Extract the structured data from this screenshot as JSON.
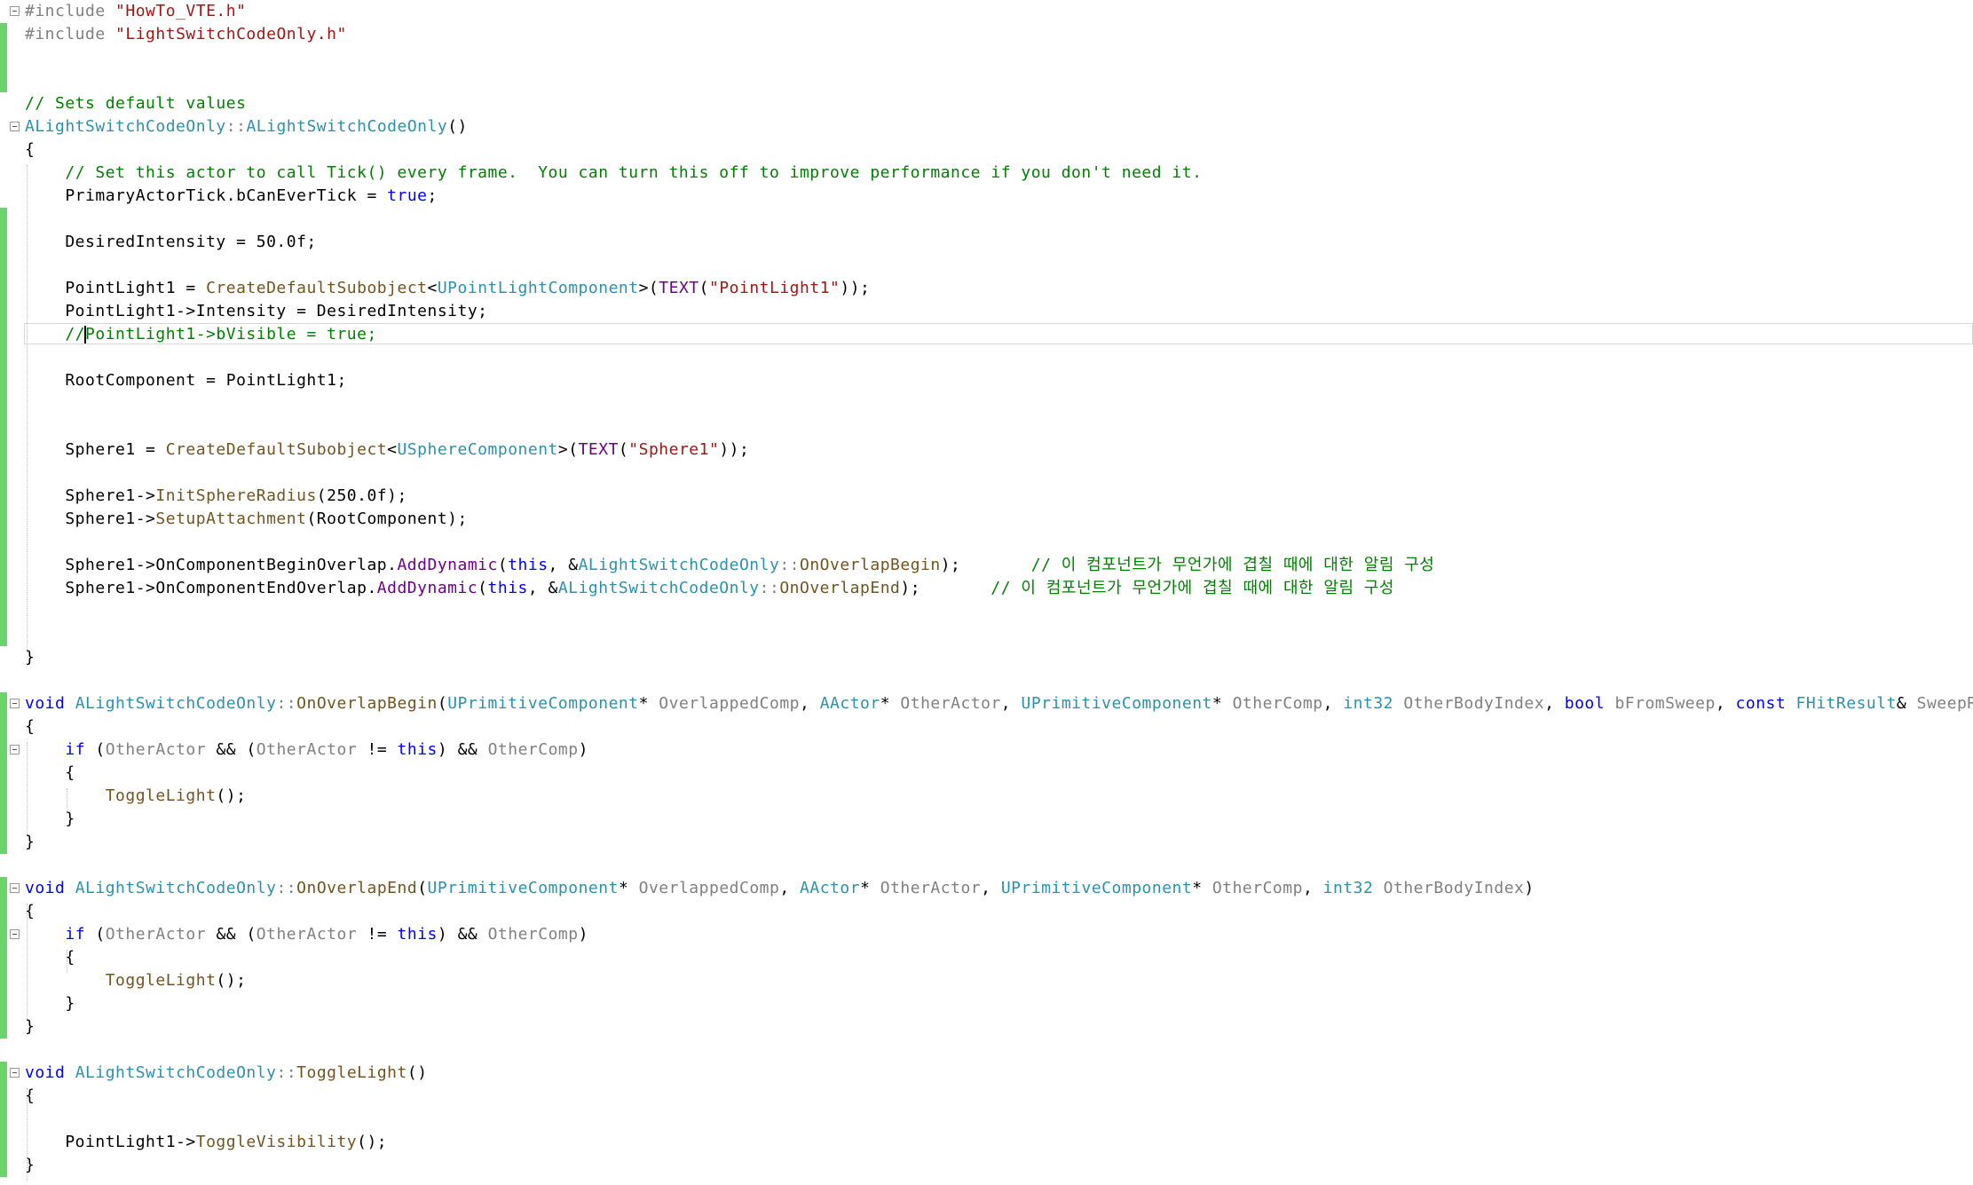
{
  "colors": {
    "keyword": "#0000FF",
    "type": "#2B91AF",
    "comment": "#008000",
    "string": "#A31515",
    "macro": "#6F008A",
    "function": "#74531F",
    "parameter": "#808080",
    "plain": "#000000",
    "change_bar": "#6CD26C"
  },
  "editor": {
    "lines": [
      {
        "green": false,
        "fold": true,
        "tokens": [
          [
            "#include ",
            "parameter"
          ],
          [
            "\"HowTo_VTE.h\"",
            "string"
          ]
        ]
      },
      {
        "green": true,
        "fold": false,
        "tokens": [
          [
            "#include ",
            "parameter"
          ],
          [
            "\"LightSwitchCodeOnly.h\"",
            "string"
          ]
        ]
      },
      {
        "green": true,
        "fold": false,
        "tokens": []
      },
      {
        "green": true,
        "fold": false,
        "tokens": []
      },
      {
        "green": false,
        "fold": false,
        "tokens": [
          [
            "// Sets default values",
            "comment"
          ]
        ]
      },
      {
        "green": false,
        "fold": true,
        "tokens": [
          [
            "ALightSwitchCodeOnly",
            "type"
          ],
          [
            "::",
            "parameter"
          ],
          [
            "ALightSwitchCodeOnly",
            "type"
          ],
          [
            "()",
            "plain"
          ]
        ]
      },
      {
        "green": false,
        "fold": false,
        "tokens": [
          [
            "{",
            "plain"
          ]
        ]
      },
      {
        "green": false,
        "fold": false,
        "tokens": [
          [
            "    ",
            "plain"
          ],
          [
            "// Set this actor to call Tick() every frame.  You can turn this off to improve performance if you don't need it.",
            "comment"
          ]
        ]
      },
      {
        "green": false,
        "fold": false,
        "tokens": [
          [
            "    PrimaryActorTick.bCanEverTick = ",
            "plain"
          ],
          [
            "true",
            "keyword"
          ],
          [
            ";",
            "plain"
          ]
        ]
      },
      {
        "green": true,
        "fold": false,
        "tokens": []
      },
      {
        "green": true,
        "fold": false,
        "tokens": [
          [
            "    DesiredIntensity = 50.0f;",
            "plain"
          ]
        ]
      },
      {
        "green": true,
        "fold": false,
        "tokens": []
      },
      {
        "green": true,
        "fold": false,
        "tokens": [
          [
            "    PointLight1 = ",
            "plain"
          ],
          [
            "CreateDefaultSubobject",
            "function"
          ],
          [
            "<",
            "plain"
          ],
          [
            "UPointLightComponent",
            "type"
          ],
          [
            ">(",
            "plain"
          ],
          [
            "TEXT",
            "macro"
          ],
          [
            "(",
            "plain"
          ],
          [
            "\"PointLight1\"",
            "string"
          ],
          [
            "));",
            "plain"
          ]
        ]
      },
      {
        "green": true,
        "fold": false,
        "tokens": [
          [
            "    PointLight1->Intensity = DesiredIntensity;",
            "plain"
          ]
        ]
      },
      {
        "green": true,
        "fold": false,
        "current": true,
        "tokens": [
          [
            "    //",
            "comment"
          ],
          [
            "CARET",
            "caret"
          ],
          [
            "PointLight1->bVisible = true;",
            "comment"
          ]
        ]
      },
      {
        "green": true,
        "fold": false,
        "tokens": []
      },
      {
        "green": true,
        "fold": false,
        "tokens": [
          [
            "    RootComponent = PointLight1;",
            "plain"
          ]
        ]
      },
      {
        "green": true,
        "fold": false,
        "tokens": []
      },
      {
        "green": true,
        "fold": false,
        "tokens": []
      },
      {
        "green": true,
        "fold": false,
        "tokens": [
          [
            "    Sphere1 = ",
            "plain"
          ],
          [
            "CreateDefaultSubobject",
            "function"
          ],
          [
            "<",
            "plain"
          ],
          [
            "USphereComponent",
            "type"
          ],
          [
            ">(",
            "plain"
          ],
          [
            "TEXT",
            "macro"
          ],
          [
            "(",
            "plain"
          ],
          [
            "\"Sphere1\"",
            "string"
          ],
          [
            "));",
            "plain"
          ]
        ]
      },
      {
        "green": true,
        "fold": false,
        "tokens": []
      },
      {
        "green": true,
        "fold": false,
        "tokens": [
          [
            "    Sphere1->",
            "plain"
          ],
          [
            "InitSphereRadius",
            "function"
          ],
          [
            "(250.0f);",
            "plain"
          ]
        ]
      },
      {
        "green": true,
        "fold": false,
        "tokens": [
          [
            "    Sphere1->",
            "plain"
          ],
          [
            "SetupAttachment",
            "function"
          ],
          [
            "(RootComponent);",
            "plain"
          ]
        ]
      },
      {
        "green": true,
        "fold": false,
        "tokens": []
      },
      {
        "green": true,
        "fold": false,
        "tokens": [
          [
            "    Sphere1->OnComponentBeginOverlap.",
            "plain"
          ],
          [
            "AddDynamic",
            "macro"
          ],
          [
            "(",
            "plain"
          ],
          [
            "this",
            "keyword"
          ],
          [
            ", &",
            "plain"
          ],
          [
            "ALightSwitchCodeOnly",
            "type"
          ],
          [
            "::",
            "parameter"
          ],
          [
            "OnOverlapBegin",
            "function"
          ],
          [
            ");       ",
            "plain"
          ],
          [
            "// 이 컴포넌트가 무언가에 겹칠 때에 대한 알림 구성",
            "comment"
          ]
        ]
      },
      {
        "green": true,
        "fold": false,
        "tokens": [
          [
            "    Sphere1->OnComponentEndOverlap.",
            "plain"
          ],
          [
            "AddDynamic",
            "macro"
          ],
          [
            "(",
            "plain"
          ],
          [
            "this",
            "keyword"
          ],
          [
            ", &",
            "plain"
          ],
          [
            "ALightSwitchCodeOnly",
            "type"
          ],
          [
            "::",
            "parameter"
          ],
          [
            "OnOverlapEnd",
            "function"
          ],
          [
            ");       ",
            "plain"
          ],
          [
            "// 이 컴포넌트가 무언가에 겹칠 때에 대한 알림 구성",
            "comment"
          ]
        ]
      },
      {
        "green": true,
        "fold": false,
        "tokens": []
      },
      {
        "green": true,
        "fold": false,
        "tokens": []
      },
      {
        "green": false,
        "fold": false,
        "tokens": [
          [
            "}",
            "plain"
          ]
        ]
      },
      {
        "green": false,
        "fold": false,
        "tokens": []
      },
      {
        "green": true,
        "fold": true,
        "tokens": [
          [
            "void",
            "keyword"
          ],
          [
            " ",
            "plain"
          ],
          [
            "ALightSwitchCodeOnly",
            "type"
          ],
          [
            "::",
            "parameter"
          ],
          [
            "OnOverlapBegin",
            "function"
          ],
          [
            "(",
            "plain"
          ],
          [
            "UPrimitiveComponent",
            "type"
          ],
          [
            "* ",
            "plain"
          ],
          [
            "OverlappedComp",
            "parameter"
          ],
          [
            ", ",
            "plain"
          ],
          [
            "AActor",
            "type"
          ],
          [
            "* ",
            "plain"
          ],
          [
            "OtherActor",
            "parameter"
          ],
          [
            ", ",
            "plain"
          ],
          [
            "UPrimitiveComponent",
            "type"
          ],
          [
            "* ",
            "plain"
          ],
          [
            "OtherComp",
            "parameter"
          ],
          [
            ", ",
            "plain"
          ],
          [
            "int32",
            "type"
          ],
          [
            " ",
            "plain"
          ],
          [
            "OtherBodyIndex",
            "parameter"
          ],
          [
            ", ",
            "plain"
          ],
          [
            "bool",
            "keyword"
          ],
          [
            " ",
            "plain"
          ],
          [
            "bFromSweep",
            "parameter"
          ],
          [
            ", ",
            "plain"
          ],
          [
            "const",
            "keyword"
          ],
          [
            " ",
            "plain"
          ],
          [
            "FHitResult",
            "type"
          ],
          [
            "& ",
            "plain"
          ],
          [
            "SweepResult",
            "parameter"
          ],
          [
            ")",
            "plain"
          ]
        ]
      },
      {
        "green": true,
        "fold": false,
        "tokens": [
          [
            "{",
            "plain"
          ]
        ]
      },
      {
        "green": true,
        "fold": true,
        "tokens": [
          [
            "    ",
            "plain"
          ],
          [
            "if",
            "keyword"
          ],
          [
            " (",
            "plain"
          ],
          [
            "OtherActor",
            "parameter"
          ],
          [
            " && (",
            "plain"
          ],
          [
            "OtherActor",
            "parameter"
          ],
          [
            " != ",
            "plain"
          ],
          [
            "this",
            "keyword"
          ],
          [
            ") && ",
            "plain"
          ],
          [
            "OtherComp",
            "parameter"
          ],
          [
            ")",
            "plain"
          ]
        ]
      },
      {
        "green": true,
        "fold": false,
        "tokens": [
          [
            "    {",
            "plain"
          ]
        ]
      },
      {
        "green": true,
        "fold": false,
        "tokens": [
          [
            "        ",
            "plain"
          ],
          [
            "ToggleLight",
            "function"
          ],
          [
            "();",
            "plain"
          ]
        ]
      },
      {
        "green": true,
        "fold": false,
        "tokens": [
          [
            "    }",
            "plain"
          ]
        ]
      },
      {
        "green": true,
        "fold": false,
        "tokens": [
          [
            "}",
            "plain"
          ]
        ]
      },
      {
        "green": false,
        "fold": false,
        "tokens": []
      },
      {
        "green": true,
        "fold": true,
        "tokens": [
          [
            "void",
            "keyword"
          ],
          [
            " ",
            "plain"
          ],
          [
            "ALightSwitchCodeOnly",
            "type"
          ],
          [
            "::",
            "parameter"
          ],
          [
            "OnOverlapEnd",
            "function"
          ],
          [
            "(",
            "plain"
          ],
          [
            "UPrimitiveComponent",
            "type"
          ],
          [
            "* ",
            "plain"
          ],
          [
            "OverlappedComp",
            "parameter"
          ],
          [
            ", ",
            "plain"
          ],
          [
            "AActor",
            "type"
          ],
          [
            "* ",
            "plain"
          ],
          [
            "OtherActor",
            "parameter"
          ],
          [
            ", ",
            "plain"
          ],
          [
            "UPrimitiveComponent",
            "type"
          ],
          [
            "* ",
            "plain"
          ],
          [
            "OtherComp",
            "parameter"
          ],
          [
            ", ",
            "plain"
          ],
          [
            "int32",
            "type"
          ],
          [
            " ",
            "plain"
          ],
          [
            "OtherBodyIndex",
            "parameter"
          ],
          [
            ")",
            "plain"
          ]
        ]
      },
      {
        "green": true,
        "fold": false,
        "tokens": [
          [
            "{",
            "plain"
          ]
        ]
      },
      {
        "green": true,
        "fold": true,
        "tokens": [
          [
            "    ",
            "plain"
          ],
          [
            "if",
            "keyword"
          ],
          [
            " (",
            "plain"
          ],
          [
            "OtherActor",
            "parameter"
          ],
          [
            " && (",
            "plain"
          ],
          [
            "OtherActor",
            "parameter"
          ],
          [
            " != ",
            "plain"
          ],
          [
            "this",
            "keyword"
          ],
          [
            ") && ",
            "plain"
          ],
          [
            "OtherComp",
            "parameter"
          ],
          [
            ")",
            "plain"
          ]
        ]
      },
      {
        "green": true,
        "fold": false,
        "tokens": [
          [
            "    {",
            "plain"
          ]
        ]
      },
      {
        "green": true,
        "fold": false,
        "tokens": [
          [
            "        ",
            "plain"
          ],
          [
            "ToggleLight",
            "function"
          ],
          [
            "();",
            "plain"
          ]
        ]
      },
      {
        "green": true,
        "fold": false,
        "tokens": [
          [
            "    }",
            "plain"
          ]
        ]
      },
      {
        "green": true,
        "fold": false,
        "tokens": [
          [
            "}",
            "plain"
          ]
        ]
      },
      {
        "green": false,
        "fold": false,
        "tokens": []
      },
      {
        "green": true,
        "fold": true,
        "tokens": [
          [
            "void",
            "keyword"
          ],
          [
            " ",
            "plain"
          ],
          [
            "ALightSwitchCodeOnly",
            "type"
          ],
          [
            "::",
            "parameter"
          ],
          [
            "ToggleLight",
            "function"
          ],
          [
            "()",
            "plain"
          ]
        ]
      },
      {
        "green": true,
        "fold": false,
        "tokens": [
          [
            "{",
            "plain"
          ]
        ]
      },
      {
        "green": true,
        "fold": false,
        "tokens": []
      },
      {
        "green": true,
        "fold": false,
        "tokens": [
          [
            "    PointLight1->",
            "plain"
          ],
          [
            "ToggleVisibility",
            "function"
          ],
          [
            "();",
            "plain"
          ]
        ]
      },
      {
        "green": true,
        "fold": false,
        "tokens": [
          [
            "}",
            "plain"
          ]
        ]
      }
    ]
  }
}
